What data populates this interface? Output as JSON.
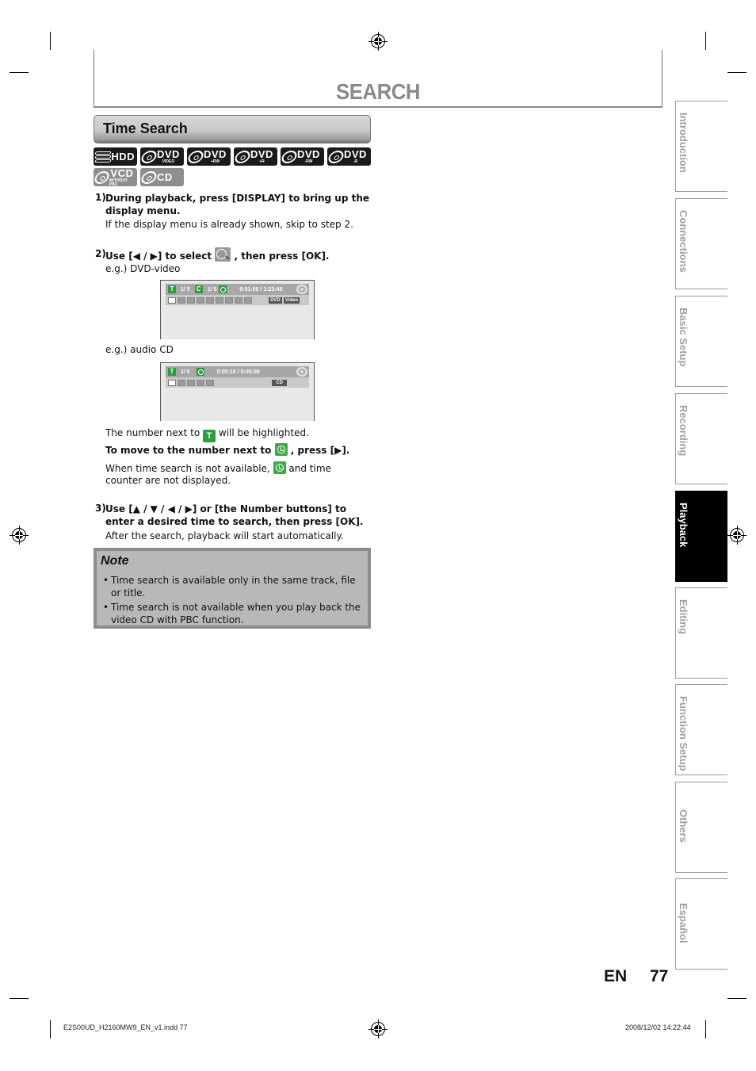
{
  "header": {
    "title": "SEARCH"
  },
  "section": {
    "title": "Time Search",
    "media_icons": [
      {
        "id": "hdd",
        "label": "HDD",
        "sub": "",
        "active": true
      },
      {
        "id": "dvd-video",
        "label": "DVD",
        "sub": "VIDEO",
        "active": true
      },
      {
        "id": "dvd-plus-rw",
        "label": "DVD",
        "sub": "+RW",
        "active": true
      },
      {
        "id": "dvd-plus-r",
        "label": "DVD",
        "sub": "+R",
        "active": true
      },
      {
        "id": "dvd-minus-rw",
        "label": "DVD",
        "sub": "-RW",
        "active": true
      },
      {
        "id": "dvd-minus-r",
        "label": "DVD",
        "sub": "-R",
        "active": true
      },
      {
        "id": "vcd",
        "label": "VCD",
        "sub": "WITHOUT PBC",
        "active": false
      },
      {
        "id": "cd",
        "label": "CD",
        "sub": "",
        "active": false
      }
    ]
  },
  "steps": {
    "s1": {
      "num": "1)",
      "bold": "During playback, press [DISPLAY] to bring up the",
      "bold2": "display menu.",
      "body": "If the display menu is already shown, skip to step 2."
    },
    "s2": {
      "num": "2)",
      "bold_pre": "Use [◀ / ▶] to select",
      "bold_post": ", then press [OK].",
      "eg_dvd": "e.g.) DVD-video",
      "eg_cd": "e.g.) audio CD"
    },
    "s2_after": {
      "highlight_pre": "The number next to",
      "highlight_post": "will be highlighted.",
      "move_pre": "To move to the number next to",
      "move_post": ", press [▶].",
      "unavail_pre": "When time search is not available,",
      "unavail_post": "and time",
      "unavail_line2": "counter are not displayed."
    },
    "s3": {
      "num": "3)",
      "bold": "Use [▲ / ▼ / ◀ / ▶] or [the Number buttons] to",
      "bold2": "enter a desired time to search, then press [OK].",
      "body": "After the search, playback will start automatically."
    }
  },
  "osd_dvd": {
    "title_icon": "T",
    "title_val": "1/   5",
    "chapter_icon": "C",
    "chapter_val": "1/   5",
    "time": "0:01:00 / 1:23:45",
    "tag1": "DVD",
    "tag2": "Video"
  },
  "osd_cd": {
    "title_icon": "T",
    "title_val": "1/   5",
    "time": "0:00:15 / 0:05:00",
    "tag1": "CD"
  },
  "icons": {
    "title_letter": "T"
  },
  "note": {
    "title": "Note",
    "items": [
      "Time search is available only in the same track, file or title.",
      "Time search is not available when you play back the video CD with PBC function."
    ]
  },
  "side_tabs": [
    {
      "label": "Introduction",
      "active": false
    },
    {
      "label": "Connections",
      "active": false
    },
    {
      "label": "Basic Setup",
      "active": false
    },
    {
      "label": "Recording",
      "active": false
    },
    {
      "label": "Playback",
      "active": true
    },
    {
      "label": "Editing",
      "active": false
    },
    {
      "label": "Function Setup",
      "active": false
    },
    {
      "label": "Others",
      "active": false
    },
    {
      "label": "Español",
      "active": false
    }
  ],
  "footer": {
    "lang": "EN",
    "page": "77",
    "slug_left": "E2S00UD_H2160MW9_EN_v1.indd   77",
    "slug_right": "2008/12/02   14:22:44"
  }
}
